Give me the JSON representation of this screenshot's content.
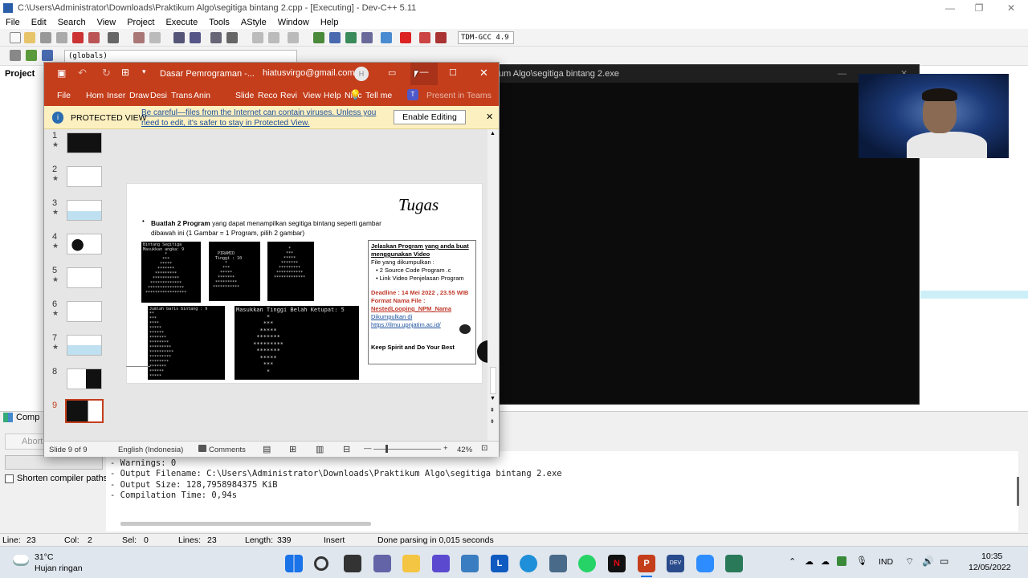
{
  "devcpp": {
    "title": "C:\\Users\\Administrator\\Downloads\\Praktikum Algo\\segitiga bintang 2.cpp - [Executing] - Dev-C++ 5.11",
    "menu": [
      "File",
      "Edit",
      "Search",
      "View",
      "Project",
      "Execute",
      "Tools",
      "AStyle",
      "Window",
      "Help"
    ],
    "compiler": "TDM-GCC 4.9",
    "scope": "(globals)",
    "project_tab": "Project",
    "compiler_tab": "Comp",
    "abort_label": "Abort",
    "shorten_label": "Shorten compiler paths",
    "log": [
      "- Errors: 0",
      "- Warnings: 0",
      "- Output Filename: C:\\Users\\Administrator\\Downloads\\Praktikum Algo\\segitiga bintang 2.exe",
      "- Output Size: 128,7958984375 KiB",
      "- Compilation Time: 0,94s"
    ],
    "status": {
      "line_label": "Line:",
      "line": "23",
      "col_label": "Col:",
      "col": "2",
      "sel_label": "Sel:",
      "sel": "0",
      "lines_label": "Lines:",
      "lines": "23",
      "length_label": "Length:",
      "length": "339",
      "mode": "Insert",
      "message": "Done parsing in 0,015 seconds"
    }
  },
  "console": {
    "title": "um Algo\\segitiga bintang 2.exe"
  },
  "ppt": {
    "filename": "Dasar Pemrograman -...",
    "account": "hiatusvirgo@gmail.com",
    "avatar": "H",
    "tabs": [
      "File",
      "Hom",
      "Inser",
      "Draw",
      "Desi",
      "Trans",
      "Anin",
      "Reco",
      "Revi",
      "View",
      "Help",
      "Nitrc"
    ],
    "tell_me": "Tell me",
    "present": "Present in Teams",
    "protected_title": "PROTECTED VIEW",
    "protected_msg1": "Be careful—files from the Internet can contain viruses. Unless you",
    "protected_msg2": "need to edit, it's safer to stay in Protected View.",
    "enable_button": "Enable Editing",
    "thumbs": [
      "1",
      "2",
      "3",
      "4",
      "5",
      "6",
      "7",
      "8",
      "9"
    ],
    "slide": {
      "title": "Tugas",
      "bullet_bold": "Buatlah  2 Program",
      "bullet_rest": " yang dapat menampilkan segitiga bintang seperti gambar",
      "bullet_line2": "dibawah ini (1 Gambar = 1 Program, pilih 2 gambar)",
      "term1_text": "Bintang Segitiga\nMasukkan angka: 9\n         *\n        ***\n       *****\n      *******\n     *********\n    ***********\n   *************\n  ***************\n *****************",
      "term2_text": "   PIRAMID\n  Tinggi : 10\n      *\n     ***\n    *****\n   *******\n  *********\n ***********",
      "term3_text": "        *\n       ***\n      *****\n     *******\n    *********\n   ***********\n  *************",
      "term4_text": "Jumlah baris bintang : 9\n**\n***\n****\n*****\n******\n*******\n********\n*********\n**********\n*********\n********\n*******\n******\n*****",
      "term5_text": "Masukkan Tinggi Belah Ketupat: 5\n         *\n        ***\n       *****\n      *******\n     *********\n      *******\n       *****\n        ***\n         *",
      "box_title": "Jelaskan Program yang anda buat menggunakan Video",
      "box_line1": "File yang dikumpulkan :",
      "box_item1": "2 Source Code Program .c",
      "box_item2": "Link Video Penjelasan Program",
      "deadline": "Deadline : 14 Mei 2022 , 23.55 WIB",
      "format_label": "Format Nama File :",
      "format_value": "NestedLooping_NPM_Nama",
      "submit_label": "Dikumpulkan di",
      "submit_url": "https://ilmu.upnjatim.ac.id/",
      "closing": "Keep Spirit and Do Your Best"
    },
    "status": {
      "slide_count": "Slide 9 of 9",
      "language": "English (Indonesia)",
      "comments": "Comments",
      "zoom": "42%"
    }
  },
  "taskbar": {
    "temp": "31°C",
    "weather": "Hujan ringan",
    "lang": "IND",
    "time": "10:35",
    "date": "12/05/2022"
  },
  "colors": {
    "ppt_accent": "#c43e1c",
    "protected_bg": "#fdf0c0",
    "deadline": "#c0392b"
  }
}
